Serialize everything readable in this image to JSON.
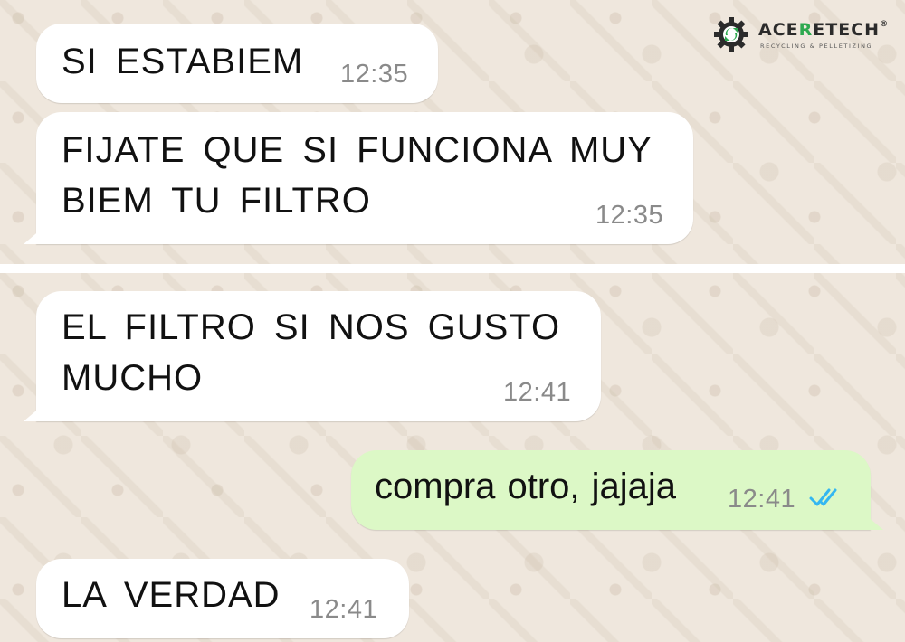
{
  "brand": {
    "name_part1": "ACE",
    "name_part2": "R",
    "name_part3": "E",
    "name_part4": "TECH",
    "registered": "®",
    "tagline": "RECYCLING & PELLETIZING",
    "accent_color": "#2DA94F"
  },
  "chat": {
    "incoming_bubble_color": "#FFFFFF",
    "outgoing_bubble_color": "#DCF8C6",
    "read_receipt_color": "#34B7F1",
    "messages": [
      {
        "direction": "incoming",
        "text": "SI   ESTABIEM",
        "time": "12:35"
      },
      {
        "direction": "incoming",
        "text": "FIJATE  QUE SI  FUNCIONA  MUY\nBIEM  TU  FILTRO",
        "time": "12:35"
      },
      {
        "direction": "incoming",
        "text": "EL  FILTRO  SI  NOS  GUSTO\nMUCHO",
        "time": "12:41"
      },
      {
        "direction": "outgoing",
        "text": "compra otro, jajaja",
        "time": "12:41",
        "status_icon": "double-check-read-icon"
      },
      {
        "direction": "incoming",
        "text": "LA  VERDAD",
        "time": "12:41"
      }
    ]
  }
}
